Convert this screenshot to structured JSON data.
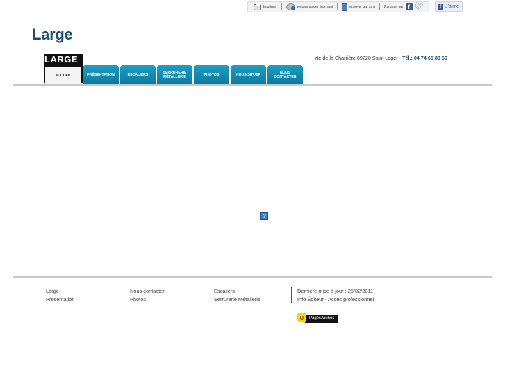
{
  "utility_bar": {
    "print_label": "Imprimer",
    "recommend_label": "recommander à un ami",
    "send_label": "envoyer par sms",
    "share_label": "Partager sur",
    "like_label": "J'aime"
  },
  "header": {
    "site_title": "Large",
    "logo_text": "LARGE",
    "address": "rte de la Charrière 69220 Saint Lager",
    "separator": "-",
    "phone": "Tél.: 04 74 66 80 69"
  },
  "nav": {
    "tabs": [
      {
        "label": "ACCUEIL",
        "active": true
      },
      {
        "label": "PRÉSENTATION"
      },
      {
        "label": "ESCALIERS"
      },
      {
        "label": "SERRURERIE MÉTALLERIE"
      },
      {
        "label": "PHOTOS"
      },
      {
        "label": "NOUS SITUER"
      },
      {
        "label": "NOUS CONTACTER"
      }
    ]
  },
  "content": {
    "placeholder_glyph": "?"
  },
  "footer": {
    "col1": [
      "Large",
      "Présentation"
    ],
    "col2": [
      "Nous contacter",
      "Photos"
    ],
    "col3": [
      "Escaliers",
      "Serrurerie Métallerie"
    ],
    "last_update": "Dernière mise à jour : 25/02/2011",
    "info_editeur": "Info Éditeur",
    "dash": "-",
    "acces_pro": "Accès professionnel",
    "pagesjaunes": "PagesJaunes"
  },
  "colors": {
    "brand": "#1b4e7c",
    "tab": "#1a9fc4"
  }
}
